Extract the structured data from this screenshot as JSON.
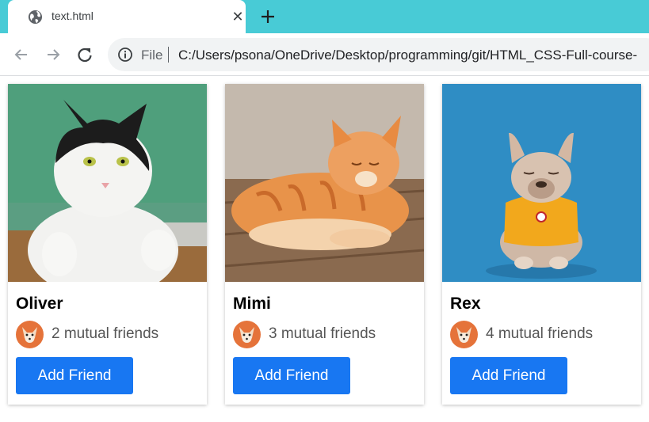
{
  "browser": {
    "tab_title": "text.html",
    "tab_close": "✕",
    "new_tab": "+",
    "file_label": "File",
    "url": "C:/Users/psona/OneDrive/Desktop/programming/git/HTML_CSS-Full-course-",
    "colors": {
      "tabstrip": "#48cbd6",
      "omnibox": "#f1f3f4"
    }
  },
  "cards": [
    {
      "name": "Oliver",
      "mutual": "2 mutual friends",
      "button": "Add Friend",
      "photo": "black-white-cat-on-green"
    },
    {
      "name": "Mimi",
      "mutual": "3 mutual friends",
      "button": "Add Friend",
      "photo": "orange-tabby-cat-lying"
    },
    {
      "name": "Rex",
      "mutual": "4 mutual friends",
      "button": "Add Friend",
      "photo": "french-bulldog-on-blue"
    }
  ],
  "colors": {
    "button": "#1877f2",
    "button_text": "#ffffff",
    "muted_text": "#555555"
  }
}
